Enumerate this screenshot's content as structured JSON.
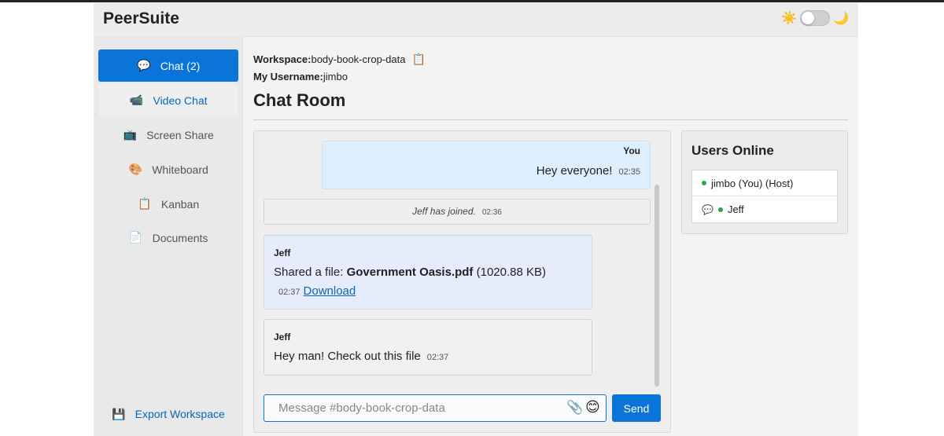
{
  "app": {
    "title": "PeerSuite"
  },
  "theme": {
    "sun_icon": "☀️",
    "moon_icon": "🌙",
    "mode": "light"
  },
  "sidebar": {
    "items": [
      {
        "label": "Chat (2)",
        "icon": "💬",
        "state": "active"
      },
      {
        "label": "Video Chat",
        "icon": "📹",
        "state": "hover"
      },
      {
        "label": "Screen Share",
        "icon": "📺",
        "state": "normal"
      },
      {
        "label": "Whiteboard",
        "icon": "🎨",
        "state": "normal"
      },
      {
        "label": "Kanban",
        "icon": "📋",
        "state": "normal"
      },
      {
        "label": "Documents",
        "icon": "📄",
        "state": "normal"
      }
    ],
    "export": {
      "label": "Export Workspace",
      "icon": "💾"
    }
  },
  "workspace": {
    "label": "Workspace:",
    "name": "body-book-crop-data",
    "copy_icon": "📋",
    "username_label": "My Username:",
    "username": "jimbo"
  },
  "room": {
    "title": "Chat Room"
  },
  "messages": [
    {
      "type": "own",
      "sender": "You",
      "text": "Hey everyone!",
      "time": "02:35"
    },
    {
      "type": "system",
      "text": "Jeff has joined.",
      "time": "02:36"
    },
    {
      "type": "file",
      "sender": "Jeff",
      "prefix": "Shared a file: ",
      "file_name": "Government Oasis.pdf",
      "file_size": "(1020.88 KB)",
      "time": "02:37",
      "link": "Download"
    },
    {
      "type": "text",
      "sender": "Jeff",
      "text": "Hey man! Check out this file",
      "time": "02:37"
    }
  ],
  "composer": {
    "placeholder": "Message #body-book-crop-data",
    "attach_icon": "📎",
    "emoji_icon": "😊",
    "send_label": "Send"
  },
  "users": {
    "title": "Users Online",
    "list": [
      {
        "name": "jimbo (You) (Host)",
        "chat_icon": ""
      },
      {
        "name": "Jeff",
        "chat_icon": "💬"
      }
    ]
  },
  "colors": {
    "accent": "#0a74d8",
    "online": "#2aa84a"
  }
}
